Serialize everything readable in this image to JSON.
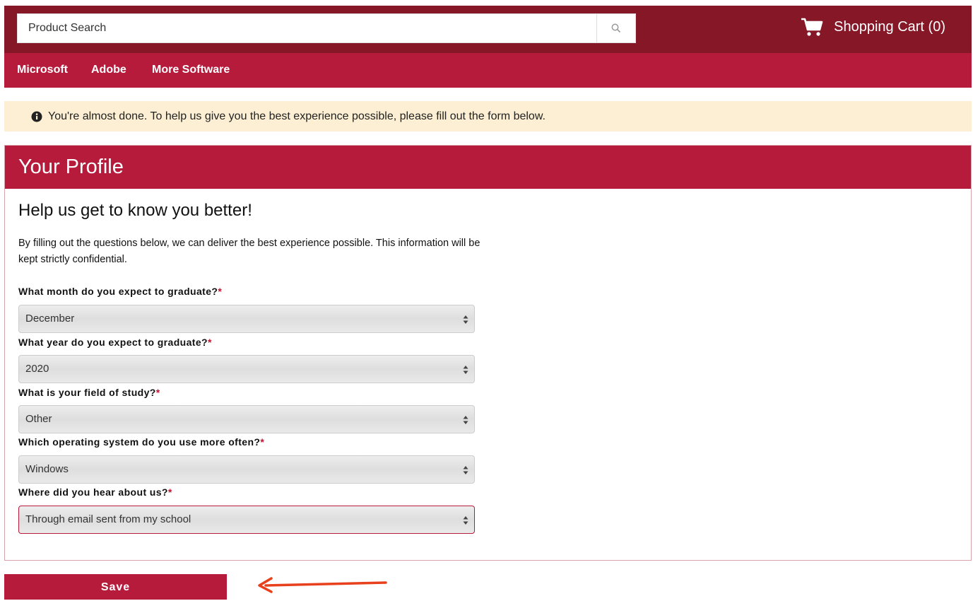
{
  "search": {
    "placeholder": "Product Search"
  },
  "cart": {
    "label": "Shopping Cart (0)"
  },
  "nav": {
    "items": [
      "Microsoft",
      "Adobe",
      "More Software"
    ]
  },
  "notice": {
    "text": "You're almost done. To help us give you the best experience possible, please fill out the form below."
  },
  "profile": {
    "title": "Your Profile",
    "subheading": "Help us get to know you better!",
    "intro": "By filling out the questions below, we can deliver the best experience possible. This information will be kept strictly confidential.",
    "required_mark": "*",
    "questions": [
      {
        "label": "What month do you expect to graduate?",
        "value": "December"
      },
      {
        "label": "What year do you expect to graduate?",
        "value": "2020"
      },
      {
        "label": "What is your field of study?",
        "value": "Other"
      },
      {
        "label": "Which operating system do you use more often?",
        "value": "Windows"
      },
      {
        "label": "Where did you hear about us?",
        "value": "Through email sent from my school"
      }
    ]
  },
  "save": {
    "label": "Save"
  },
  "colors": {
    "header_dark": "#861727",
    "brand": "#b61b3c",
    "notice_bg": "#fcefd3",
    "arrow": "#e8401c"
  },
  "icons": [
    "search-icon",
    "cart-icon",
    "info-icon",
    "select-arrows-icon",
    "annotation-arrow-icon"
  ]
}
